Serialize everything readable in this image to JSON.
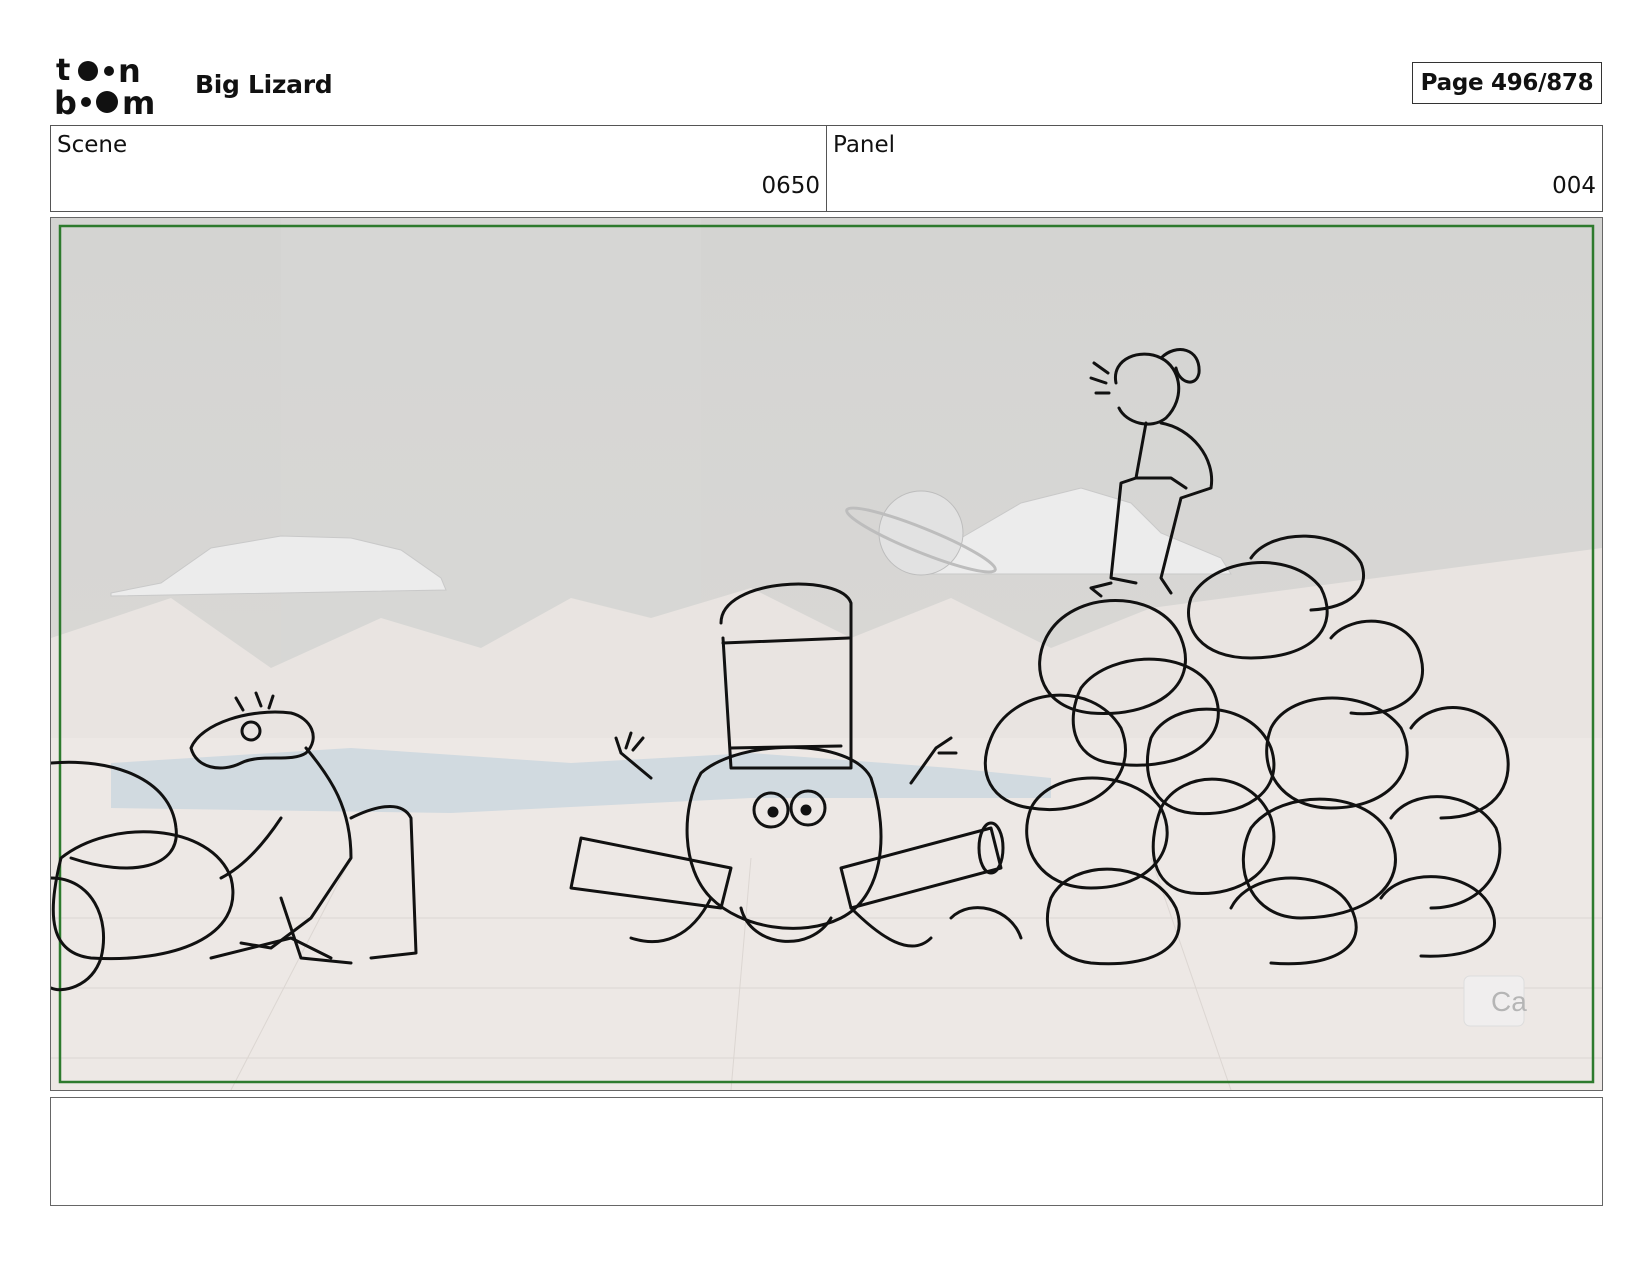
{
  "header": {
    "logo_text": "toon boom",
    "project_title": "Big Lizard",
    "page_counter": "Page 496/878"
  },
  "info": {
    "scene_label": "Scene",
    "scene_value": "0650",
    "panel_label": "Panel",
    "panel_value": "004"
  },
  "panel_overlay": {
    "partial_text": "Ca"
  },
  "caption": {
    "text": ""
  }
}
